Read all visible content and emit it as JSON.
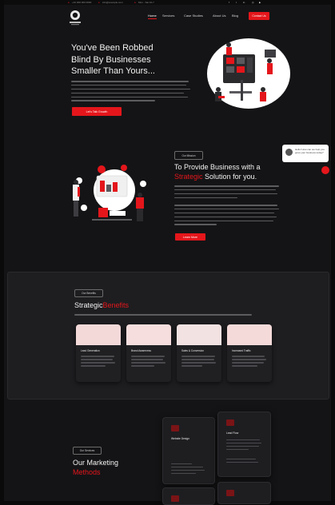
{
  "topbar": {
    "phone": "+91 000 000 0000",
    "email": "info@example.com",
    "hours": "Mon - Sat 10-7",
    "social_icons": [
      "facebook-icon",
      "twitter-icon",
      "linkedin-icon",
      "instagram-icon",
      "youtube-icon"
    ]
  },
  "nav": {
    "items": [
      "Home",
      "Services",
      "Case Studies",
      "About Us",
      "Blog"
    ],
    "active": "Home",
    "cta": "Contact Us"
  },
  "hero": {
    "title_line1": "You've Been Robbed",
    "title_line2": "Blind By Businesses",
    "title_line3": "Smaller Than Yours...",
    "button": "Let's Talk Growth"
  },
  "about": {
    "tag": "Our Mission",
    "title_pre": "To Provide Business with a",
    "title_red": "Strategic",
    "title_post": "Solution for you.",
    "button": "Learn More"
  },
  "benefits": {
    "tag": "Our Benefits",
    "title_pre": "Strategic",
    "title_red": "Benefits",
    "cards": [
      {
        "title": "Lead Generation"
      },
      {
        "title": "Brand Awareness"
      },
      {
        "title": "Sales & Conversion"
      },
      {
        "title": "Increased Traffic"
      }
    ]
  },
  "methods": {
    "tag": "Our Services",
    "title_line1": "Our Marketing",
    "title_line2": "Methods",
    "cards": [
      {
        "title": "Website Design"
      },
      {
        "title": "Lead Flow"
      }
    ]
  },
  "chat": {
    "message": "Hello! How can we help you grow your business today?"
  },
  "colors": {
    "accent": "#e4161b",
    "background": "#141416",
    "panel": "#1e1e21"
  }
}
